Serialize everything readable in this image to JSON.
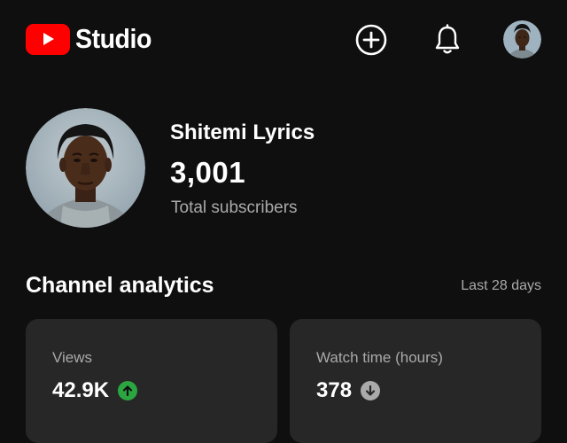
{
  "app": {
    "logo_text": "Studio",
    "logo_icon": "youtube-play-icon",
    "brand_color": "#ff0000"
  },
  "header": {
    "create_icon": "plus-circle-icon",
    "notifications_icon": "bell-icon",
    "account_icon": "avatar"
  },
  "channel": {
    "name": "Shitemi Lyrics",
    "subscriber_count": "3,001",
    "subscriber_label": "Total subscribers"
  },
  "analytics": {
    "title": "Channel analytics",
    "period": "Last 28 days",
    "cards": [
      {
        "label": "Views",
        "value": "42.9K",
        "trend": "up",
        "trend_icon": "arrow-up-icon",
        "trend_color": "#2ba640"
      },
      {
        "label": "Watch time (hours)",
        "value": "378",
        "trend": "down",
        "trend_icon": "arrow-down-icon",
        "trend_color": "#aaaaaa"
      }
    ]
  }
}
